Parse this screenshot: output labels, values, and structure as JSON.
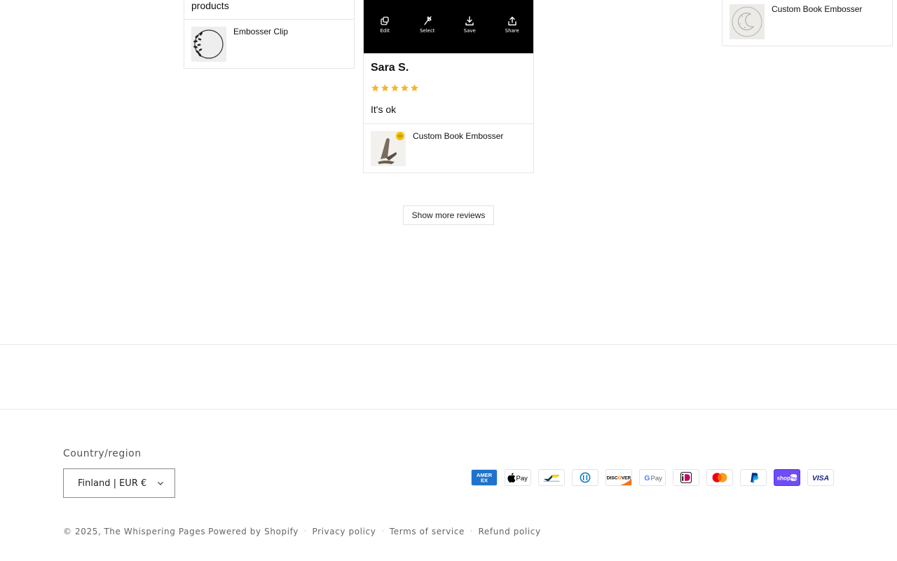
{
  "reviews": {
    "left_card": {
      "top_text": "products",
      "product_name": "Embosser Clip"
    },
    "middle_card": {
      "photo_tools": [
        {
          "label": "Edit",
          "icon": "edit-icon"
        },
        {
          "label": "Select",
          "icon": "select-icon"
        },
        {
          "label": "Save",
          "icon": "download-icon"
        },
        {
          "label": "Share",
          "icon": "share-icon"
        }
      ],
      "reviewer": "Sara S.",
      "rating": 5,
      "rating_max": 5,
      "text": "It's ok",
      "product_name": "Custom Book Embosser"
    },
    "right_card": {
      "product_name": "Custom Book Embosser"
    },
    "show_more_label": "Show more reviews"
  },
  "footer": {
    "country_label": "Country/region",
    "country_value": "Finland | EUR €",
    "payment_methods": [
      {
        "name": "American Express",
        "icon": "amex-icon"
      },
      {
        "name": "Apple Pay",
        "icon": "apple-pay-icon"
      },
      {
        "name": "Bancontact",
        "icon": "bancontact-icon"
      },
      {
        "name": "Diners Club",
        "icon": "diners-club-icon"
      },
      {
        "name": "Discover",
        "icon": "discover-icon"
      },
      {
        "name": "Google Pay",
        "icon": "google-pay-icon"
      },
      {
        "name": "iDEAL",
        "icon": "ideal-icon"
      },
      {
        "name": "Mastercard",
        "icon": "mastercard-icon"
      },
      {
        "name": "PayPal",
        "icon": "paypal-icon"
      },
      {
        "name": "Shop Pay",
        "icon": "shop-pay-icon"
      },
      {
        "name": "Visa",
        "icon": "visa-icon"
      }
    ],
    "copyright": "© 2025,",
    "store_name": "The Whispering Pages",
    "powered_by": "Powered by Shopify",
    "links": [
      "Privacy policy",
      "Terms of service",
      "Refund policy"
    ],
    "separator": "·"
  },
  "colors": {
    "star": "#f2b630",
    "border": "#e6e6e6",
    "text": "#111111",
    "muted": "#666666"
  }
}
